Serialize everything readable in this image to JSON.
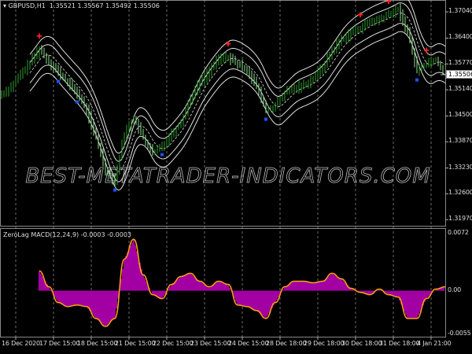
{
  "header": {
    "symbol": "GBPUSD,H1",
    "ohlc": "1.35521 1.35567 1.35492 1.35506"
  },
  "watermark": "BEST-METATRADER-INDICATORS.COM",
  "current_price_label": "1.35506",
  "colors": {
    "background": "#000000",
    "bull": "#2f9e2f",
    "bear": "#8fe08f",
    "bands": "#e0e0e0",
    "histogram": "#cc00cc",
    "signal": "#ffa500",
    "up_marker": "#ff2020",
    "down_marker": "#2050ff",
    "grid": "#9a9a9a"
  },
  "chart_data": [
    {
      "type": "line",
      "title": "GBPUSD,H1",
      "series": [
        {
          "values": [
            1.35024,
            1.35216,
            1.35504,
            1.35792,
            1.36138,
            1.3583,
            1.35562,
            1.35312,
            1.35062,
            1.3464,
            1.33968,
            1.332,
            1.32912,
            1.34064,
            1.34448,
            1.33968,
            1.33584,
            1.33776,
            1.34064,
            1.34352,
            1.34928,
            1.35312,
            1.356,
            1.35888,
            1.35946,
            1.35754,
            1.35638,
            1.35216,
            1.3464,
            1.34736,
            1.35062,
            1.35178,
            1.35254,
            1.35408,
            1.35696,
            1.3608,
            1.36368,
            1.36522,
            1.36656,
            1.3679,
            1.36848,
            1.36982,
            1.37098,
            1.3656,
            1.356,
            1.35792,
            1.35888,
            1.35506
          ]
        }
      ],
      "up_markers": [
        4,
        24,
        38,
        41,
        45
      ],
      "down_markers": [
        6,
        8,
        12,
        17,
        28,
        44
      ],
      "y_ticks": [
        "1.37040",
        "1.36400",
        "1.35770",
        "1.35140",
        "1.34500",
        "1.33870",
        "1.33230",
        "1.32600",
        "1.31970"
      ],
      "ylim": [
        1.3182,
        1.3733
      ]
    },
    {
      "type": "bar",
      "title": "ZeroLag MACD(12,24,9) -0.0003 -0.0003",
      "series": [
        {
          "values": [
            null,
            null,
            null,
            null,
            0.0025,
            0.0005,
            -0.0015,
            -0.002,
            -0.0018,
            -0.002,
            -0.0035,
            -0.0045,
            -0.0035,
            0.004,
            0.0065,
            0.002,
            -0.0005,
            -0.001,
            0.0008,
            0.0018,
            0.0022,
            0.0012,
            0.0005,
            0.0012,
            0.0008,
            -0.0018,
            -0.002,
            -0.0025,
            -0.0035,
            -0.0015,
            0.0005,
            0.0012,
            0.0012,
            0.001,
            0.0012,
            0.0022,
            0.0015,
            0.0003,
            -0.0002,
            -0.0005,
            0.0002,
            -0.0005,
            -0.0008,
            -0.0035,
            -0.0035,
            -0.001,
            0.0002,
            0.0005
          ]
        }
      ],
      "y_ticks": [
        "0.0072",
        "0.00",
        "-0.0055"
      ],
      "y_tick_values": [
        0.0072,
        0,
        -0.0055
      ],
      "ylim": [
        -0.0058,
        0.0079
      ]
    }
  ],
  "x_ticks": [
    "16 Dec 2020",
    "17 Dec 15:00",
    "18 Dec 15:00",
    "21 Dec 15:00",
    "22 Dec 15:00",
    "23 Dec 15:00",
    "24 Dec 15:00",
    "28 Dec 18:00",
    "29 Dec 18:00",
    "30 Dec 18:00",
    "31 Dec 18:00",
    "4 Jan 21:00"
  ]
}
